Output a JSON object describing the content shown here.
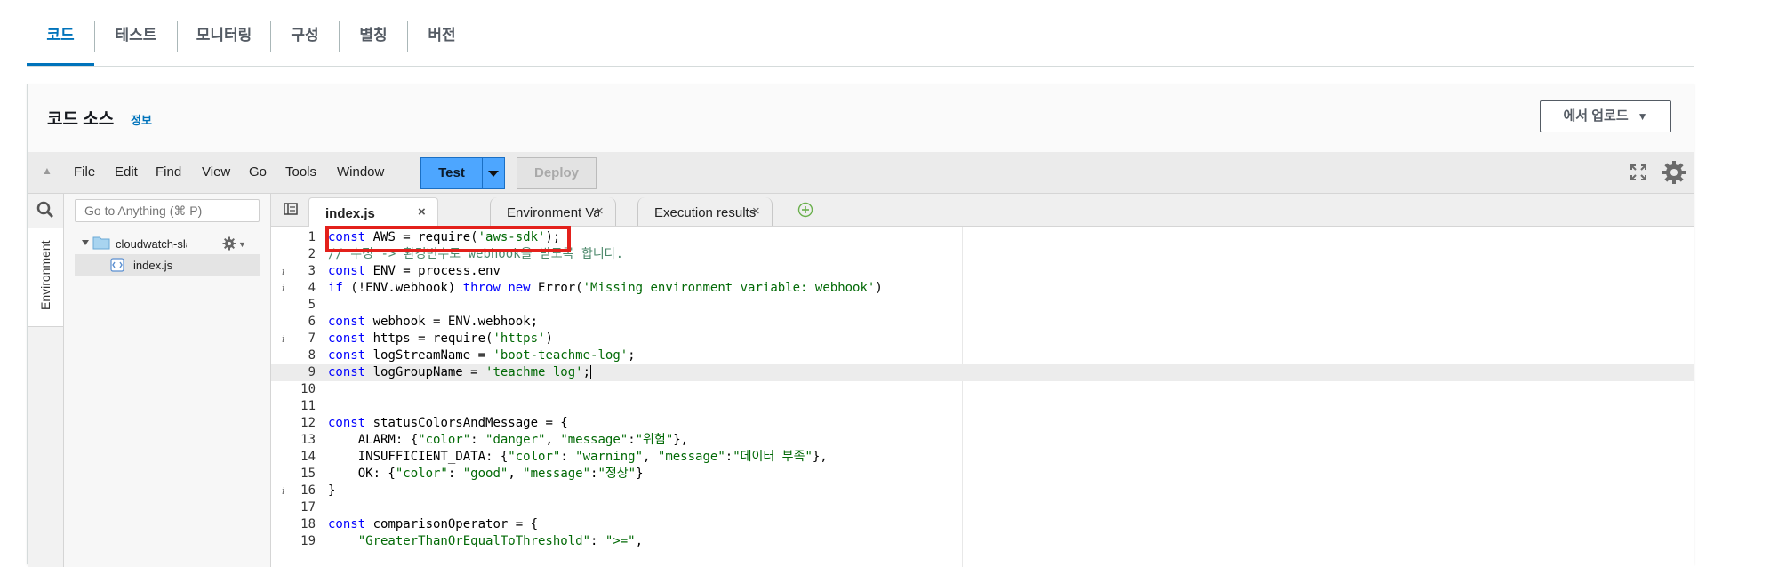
{
  "tabs": [
    {
      "label": "코드",
      "active": true
    },
    {
      "label": "테스트",
      "active": false
    },
    {
      "label": "모니터링",
      "active": false
    },
    {
      "label": "구성",
      "active": false
    },
    {
      "label": "별칭",
      "active": false
    },
    {
      "label": "버전",
      "active": false
    }
  ],
  "panel": {
    "title": "코드 소스",
    "info_link": "정보",
    "upload_label": "에서 업로드",
    "upload_arrow": "▼"
  },
  "menubar": {
    "collapse_glyph": "▲",
    "items": [
      "File",
      "Edit",
      "Find",
      "View",
      "Go",
      "Tools",
      "Window"
    ],
    "test_label": "Test",
    "deploy_label": "Deploy"
  },
  "sidebar": {
    "env_tab_label": "Environment",
    "goto_placeholder": "Go to Anything (⌘ P)",
    "folder_name": "cloudwatch-slack-alarm",
    "file_name": "index.js"
  },
  "editor_tabs": [
    {
      "label": "index.js",
      "active": true
    },
    {
      "label": "Environment Variables",
      "active": false
    },
    {
      "label": "Execution results",
      "active": false
    }
  ],
  "editor": {
    "current_line": 9,
    "lines": [
      {
        "n": "1",
        "info": "",
        "html": "<span class=\"kw\">const</span> AWS = require(<span class=\"str\">'aws-sdk'</span>);"
      },
      {
        "n": "2",
        "info": "",
        "html": "<span class=\"cmt\">// 수정 -> 환경변수로 webhook을 받도록 합니다.</span>"
      },
      {
        "n": "3",
        "info": "i",
        "html": "<span class=\"kw\">const</span> ENV = process.env"
      },
      {
        "n": "4",
        "info": "i",
        "html": "<span class=\"kw\">if</span> (!ENV.webhook) <span class=\"kw\">throw</span> <span class=\"kw\">new</span> Error(<span class=\"str\">'Missing environment variable: webhook'</span>)"
      },
      {
        "n": "5",
        "info": "",
        "html": ""
      },
      {
        "n": "6",
        "info": "",
        "html": "<span class=\"kw\">const</span> webhook = ENV.webhook;"
      },
      {
        "n": "7",
        "info": "i",
        "html": "<span class=\"kw\">const</span> https = require(<span class=\"str\">'https'</span>)"
      },
      {
        "n": "8",
        "info": "",
        "html": "<span class=\"kw\">const</span> logStreamName = <span class=\"str\">'boot-teachme-log'</span>;"
      },
      {
        "n": "9",
        "info": "",
        "html": "<span class=\"kw\">const</span> logGroupName = <span class=\"str\">'teachme_log'</span>;<span class=\"cursor\"></span>"
      },
      {
        "n": "10",
        "info": "",
        "html": ""
      },
      {
        "n": "11",
        "info": "",
        "html": ""
      },
      {
        "n": "12",
        "info": "",
        "html": "<span class=\"kw\">const</span> statusColorsAndMessage = {"
      },
      {
        "n": "13",
        "info": "",
        "html": "    ALARM: {<span class=\"str\">\"color\"</span>: <span class=\"str\">\"danger\"</span>, <span class=\"str\">\"message\"</span>:<span class=\"str\">\"위험\"</span>},"
      },
      {
        "n": "14",
        "info": "",
        "html": "    INSUFFICIENT_DATA: {<span class=\"str\">\"color\"</span>: <span class=\"str\">\"warning\"</span>, <span class=\"str\">\"message\"</span>:<span class=\"str\">\"데이터 부족\"</span>},"
      },
      {
        "n": "15",
        "info": "",
        "html": "    OK: {<span class=\"str\">\"color\"</span>: <span class=\"str\">\"good\"</span>, <span class=\"str\">\"message\"</span>:<span class=\"str\">\"정상\"</span>}"
      },
      {
        "n": "16",
        "info": "i",
        "html": "}"
      },
      {
        "n": "17",
        "info": "",
        "html": ""
      },
      {
        "n": "18",
        "info": "",
        "html": "<span class=\"kw\">const</span> comparisonOperator = {"
      },
      {
        "n": "19",
        "info": "",
        "html": "    <span class=\"str\">\"GreaterThanOrEqualToThreshold\"</span>: <span class=\"str\">\">=\"</span>,"
      }
    ]
  },
  "colors": {
    "accent": "#0073bb",
    "test_button": "#4da6ff",
    "highlight_box": "#e3201b"
  }
}
